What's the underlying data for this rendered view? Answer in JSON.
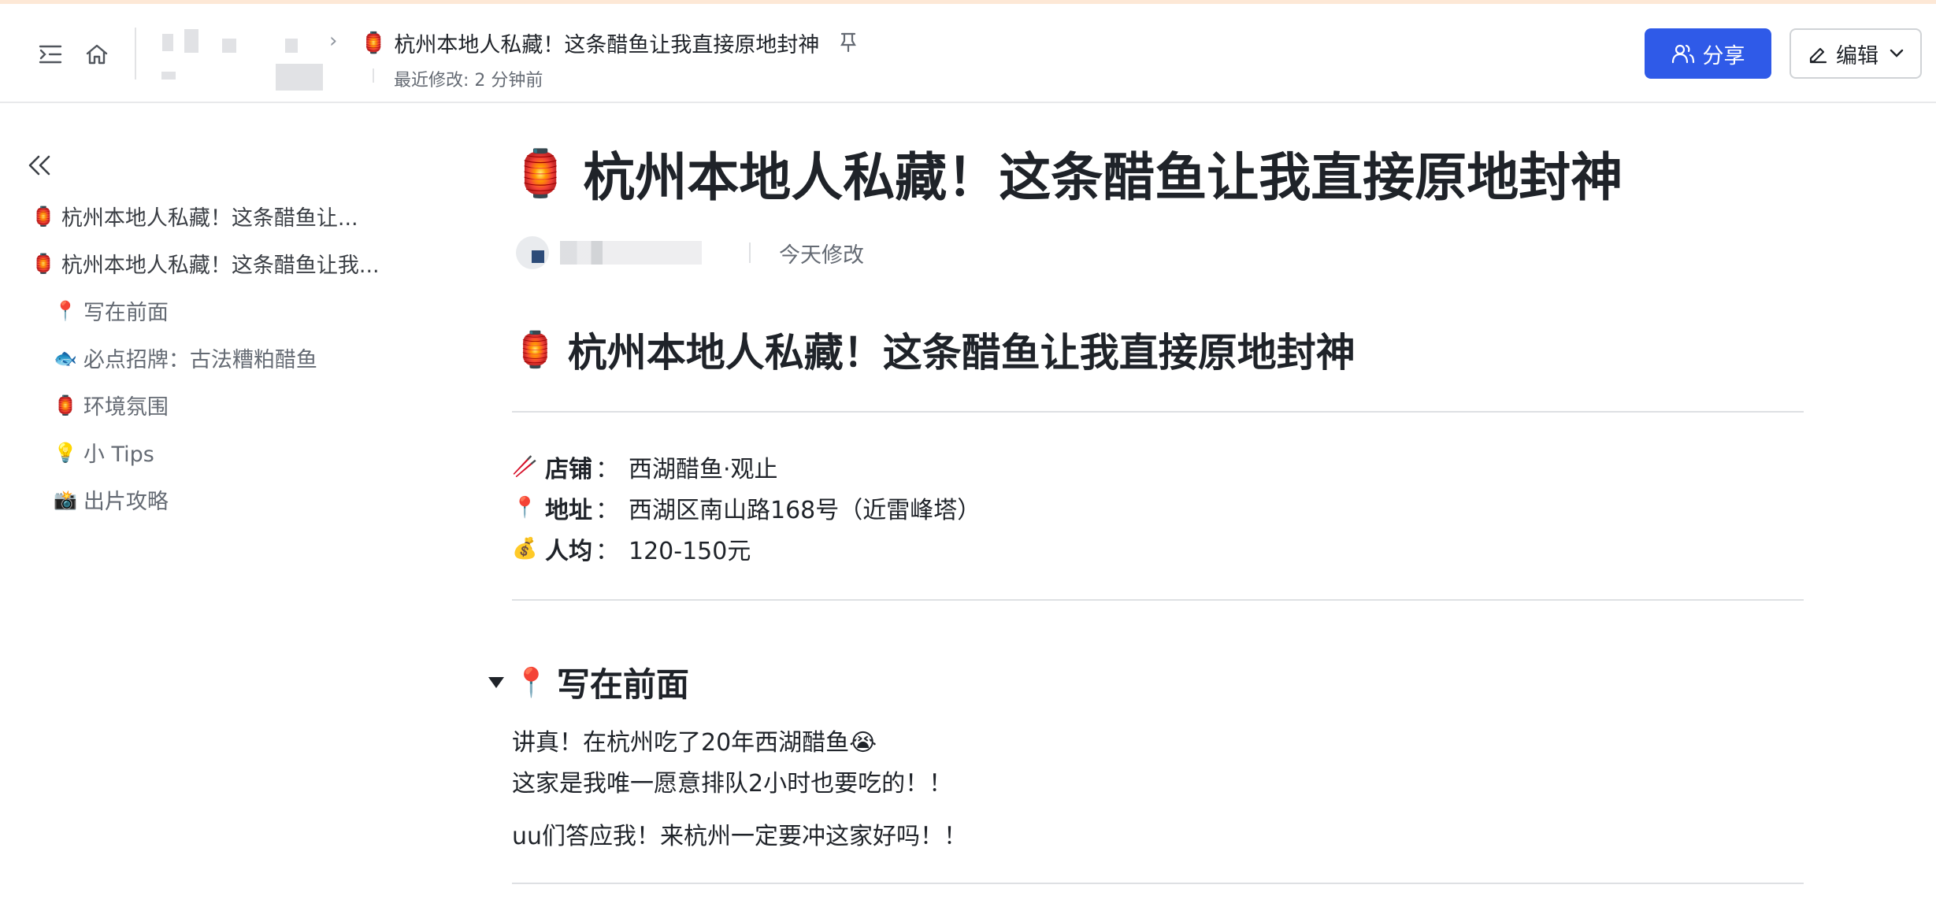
{
  "header": {
    "breadcrumb_emoji": "🏮",
    "doc_title": "杭州本地人私藏！这条醋鱼让我直接原地封神",
    "last_modified": "最近修改: 2 分钟前",
    "share_label": "分享",
    "edit_label": "编辑",
    "colors": {
      "accent": "#2f5ae8"
    }
  },
  "sidebar": {
    "items": [
      {
        "emoji": "🏮",
        "label": "杭州本地人私藏！这条醋鱼让..."
      },
      {
        "emoji": "🏮",
        "label": "杭州本地人私藏！这条醋鱼让我..."
      },
      {
        "emoji": "📍",
        "label": "写在前面"
      },
      {
        "emoji": "🐟",
        "label": "必点招牌：古法糟粕醋鱼"
      },
      {
        "emoji": "🏮",
        "label": "环境氛围"
      },
      {
        "emoji": "💡",
        "label": "小 Tips"
      },
      {
        "emoji": "📸",
        "label": "出片攻略"
      }
    ]
  },
  "main": {
    "title_emoji": "🏮",
    "title": "杭州本地人私藏！这条醋鱼让我直接原地封神",
    "meta_time": "今天修改",
    "h2_emoji": "🏮",
    "h2": "杭州本地人私藏！这条醋鱼让我直接原地封神",
    "info": [
      {
        "emoji": "🥢",
        "key": "店铺",
        "sep": "：",
        "value": "西湖醋鱼·观止"
      },
      {
        "emoji": "📍",
        "key": "地址",
        "sep": "：",
        "value": "西湖区南山路168号（近雷峰塔）"
      },
      {
        "emoji": "💰",
        "key": "人均",
        "sep": "：",
        "value": "120-150元"
      }
    ],
    "section_emoji": "📍",
    "section_title": "写在前面",
    "paragraphs": [
      "讲真！在杭州吃了20年西湖醋鱼😭",
      "这家是我唯一愿意排队2小时也要吃的！！",
      "uu们答应我！来杭州一定要冲这家好吗！！"
    ]
  }
}
